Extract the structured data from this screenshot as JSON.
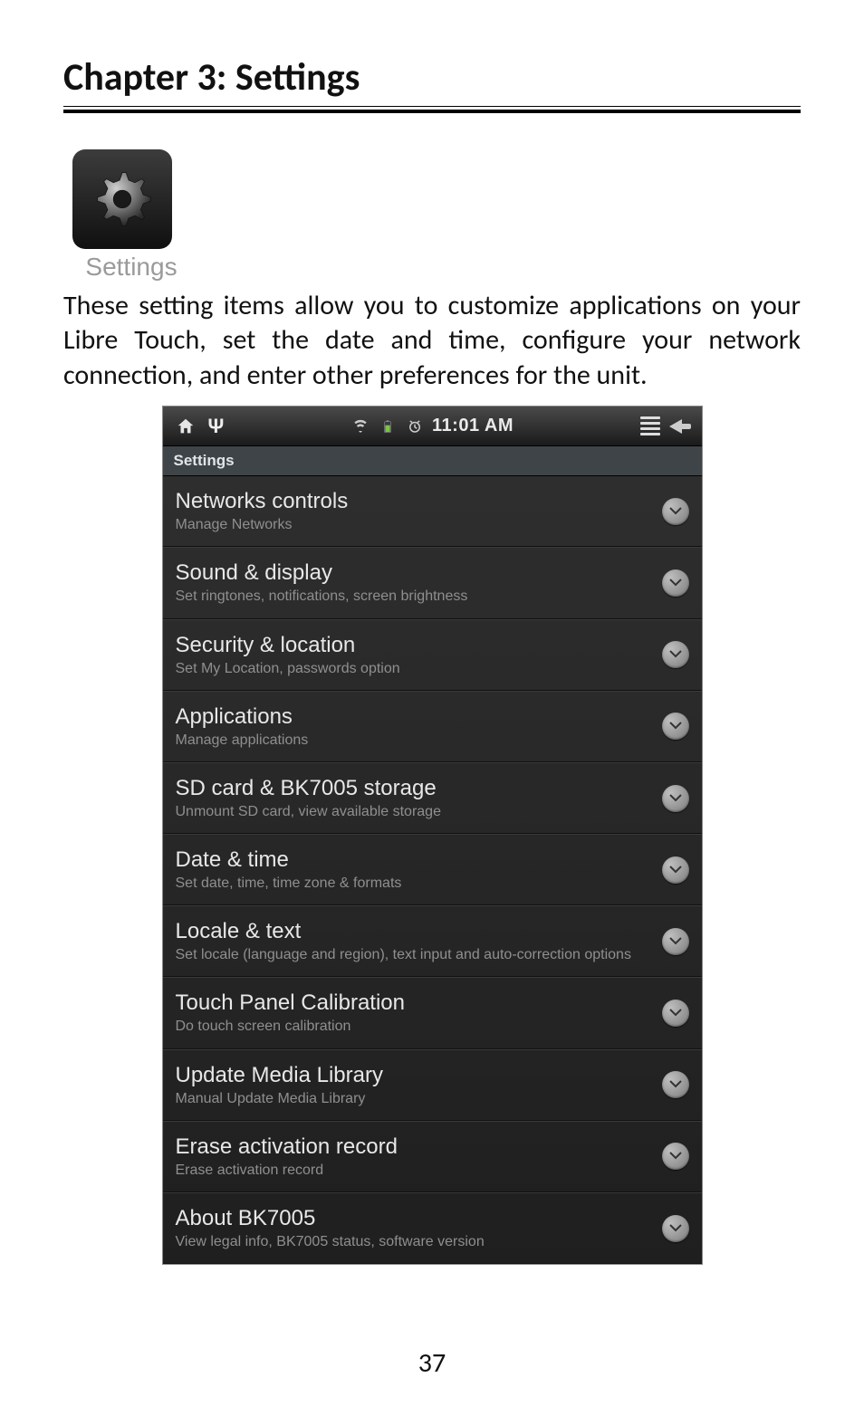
{
  "chapter_title": "Chapter 3: Settings",
  "settings_icon_caption": "Settings",
  "body_paragraph": "These setting items allow you to customize applications on your Libre Touch, set the date and time, configure your network connection, and enter other preferences for the unit.",
  "status_bar": {
    "time": "11:01 AM"
  },
  "screen": {
    "header": "Settings",
    "items": [
      {
        "title": "Networks controls",
        "subtitle": "Manage Networks"
      },
      {
        "title": "Sound & display",
        "subtitle": "Set ringtones, notifications, screen brightness"
      },
      {
        "title": "Security & location",
        "subtitle": "Set My Location, passwords option"
      },
      {
        "title": "Applications",
        "subtitle": "Manage applications"
      },
      {
        "title": "SD card & BK7005 storage",
        "subtitle": "Unmount SD card, view available storage"
      },
      {
        "title": "Date & time",
        "subtitle": "Set date, time, time zone & formats"
      },
      {
        "title": "Locale & text",
        "subtitle": "Set locale (language and region), text input and auto-correction options"
      },
      {
        "title": "Touch Panel Calibration",
        "subtitle": "Do touch screen calibration"
      },
      {
        "title": "Update Media Library",
        "subtitle": "Manual Update Media Library"
      },
      {
        "title": "Erase activation record",
        "subtitle": "Erase activation record"
      },
      {
        "title": "About BK7005",
        "subtitle": "View legal info, BK7005 status, software version"
      }
    ]
  },
  "page_number": "37"
}
